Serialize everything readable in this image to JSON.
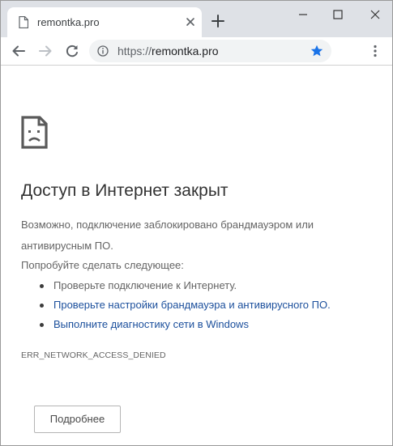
{
  "tab": {
    "title": "remontka.pro"
  },
  "omnibox": {
    "url_scheme": "https://",
    "url_host": "remontka.pro"
  },
  "error_page": {
    "heading": "Доступ в Интернет закрыт",
    "description": "Возможно, подключение заблокировано брандмауэром или антивирусным ПО.",
    "try_label": "Попробуйте сделать следующее:",
    "suggestions": [
      {
        "text": "Проверьте подключение к Интернету.",
        "is_link": false
      },
      {
        "text": "Проверьте настройки брандмауэра и антивирусного ПО.",
        "is_link": true
      },
      {
        "text": "Выполните диагностику сети в Windows",
        "is_link": true
      }
    ],
    "error_code": "ERR_NETWORK_ACCESS_DENIED",
    "details_button": "Подробнее"
  },
  "icons": {
    "favicon": "page-icon",
    "tab_close": "close-icon",
    "new_tab": "plus-icon",
    "minimize": "minimize-icon",
    "maximize": "maximize-icon",
    "close_window": "close-icon",
    "back": "arrow-left-icon",
    "forward": "arrow-right-icon",
    "reload": "reload-icon",
    "site_info": "info-icon",
    "bookmark": "star-icon",
    "menu": "kebab-menu-icon",
    "error": "sad-page-icon"
  },
  "colors": {
    "titlebar": "#dee1e6",
    "omnibox": "#f1f3f4",
    "link": "#1b4f9c",
    "bookmark_star": "#1a73e8",
    "heading": "#333333",
    "body_text": "#646464"
  }
}
